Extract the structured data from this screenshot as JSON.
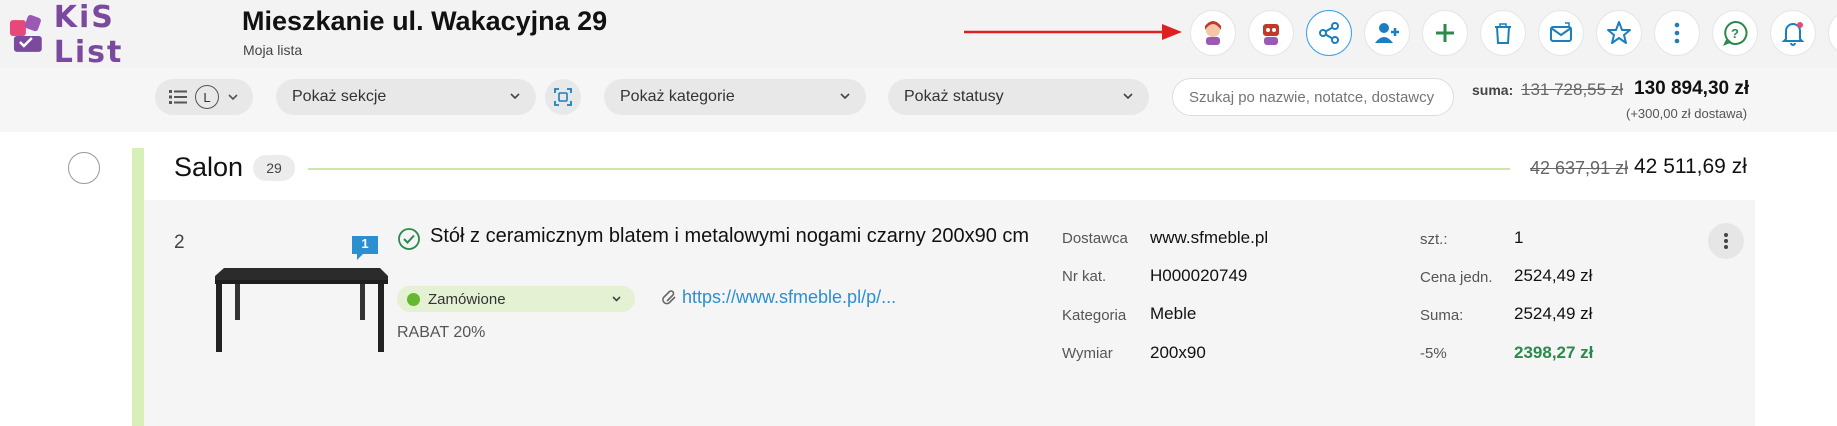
{
  "app": {
    "logo_text": "KiS List",
    "title": "Mieszkanie ul. Wakacyjna 29",
    "subtitle": "Moja lista"
  },
  "toolbar": {
    "buttons": [
      {
        "name": "avatar-female-icon",
        "color": "#c0392b"
      },
      {
        "name": "avatar-robot-icon",
        "color": "#9b59b6"
      },
      {
        "name": "share-icon",
        "active": true
      },
      {
        "name": "add-user-icon"
      },
      {
        "name": "plus-icon"
      },
      {
        "name": "trash-icon"
      },
      {
        "name": "mail-sync-icon"
      },
      {
        "name": "star-icon"
      },
      {
        "name": "more-vertical-icon"
      },
      {
        "name": "whatsapp-help-icon"
      },
      {
        "name": "bell-icon"
      },
      {
        "name": "user-profile-icon"
      }
    ],
    "accent": "#1a7fbf"
  },
  "filters": {
    "view_size": "L",
    "sections_label": "Pokaż sekcje",
    "categories_label": "Pokaż kategorie",
    "statuses_label": "Pokaż statusy",
    "search_placeholder": "Szukaj po nazwie, notatce, dostawcy"
  },
  "summary": {
    "label": "suma:",
    "old_total": "131 728,55 zł",
    "new_total": "130 894,30 zł",
    "delivery": "(+300,00 zł dostawa)"
  },
  "section": {
    "title": "Salon",
    "count": "29",
    "old_total": "42 637,91 zł",
    "new_total": "42 511,69 zł"
  },
  "item": {
    "index": "2",
    "comments": "1",
    "name": "Stół z ceramicznym blatem i metalowymi nogami czarny 200x90 cm",
    "status": "Zamówione",
    "link": "https://www.sfmeble.pl/p/...",
    "note": "RABAT 20%",
    "details": {
      "supplier_label": "Dostawca",
      "supplier": "www.sfmeble.pl",
      "catalog_label": "Nr kat.",
      "catalog": "H000020749",
      "category_label": "Kategoria",
      "category": "Meble",
      "dimension_label": "Wymiar",
      "dimension": "200x90"
    },
    "pricing": {
      "qty_label": "szt.:",
      "qty": "1",
      "unit_price_label": "Cena jedn.",
      "unit_price": "2524,49 zł",
      "sum_label": "Suma:",
      "sum": "2524,49 zł",
      "discount_label": "-5%",
      "discounted": "2398,27 zł"
    }
  }
}
